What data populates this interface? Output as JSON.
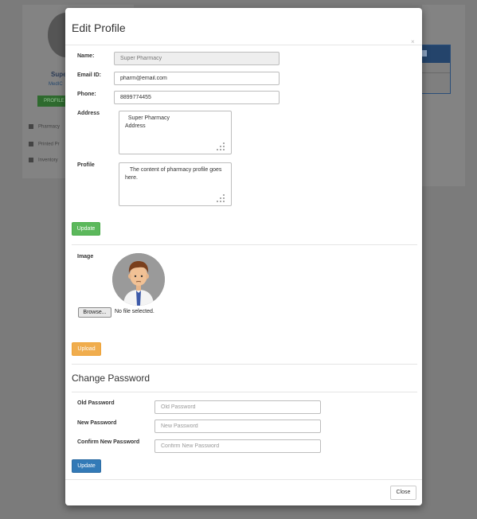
{
  "background": {
    "profile_name": "Super",
    "profile_sub": "MedIC",
    "profile_button": "PROFILE",
    "nav": [
      "Pharmacy",
      "Printed Pr",
      "Inventory"
    ]
  },
  "modal": {
    "title": "Edit Profile",
    "close_x": "×",
    "profile_form": {
      "name_label": "Name:",
      "name_value": "Super Pharmacy",
      "email_label": "Email ID:",
      "email_value": "pharm@email.com",
      "phone_label": "Phone:",
      "phone_value": "8899774455",
      "address_label": "Address",
      "address_value": "  Super Pharmacy\nAddress",
      "profile_label": "Profile",
      "profile_value": "   The content of pharmacy profile goes here.",
      "update_label": "Update"
    },
    "image_form": {
      "image_label": "Image",
      "browse_label": "Browse...",
      "file_status": "No file selected.",
      "upload_label": "Upload"
    },
    "password_form": {
      "title": "Change Password",
      "old_label": "Old Password",
      "old_placeholder": "Old Password",
      "new_label": "New Password",
      "new_placeholder": "New Password",
      "confirm_label": "Confirm New Password",
      "confirm_placeholder": "Confirm New Password",
      "update_label": "Update"
    },
    "footer": {
      "close_label": "Close"
    }
  }
}
